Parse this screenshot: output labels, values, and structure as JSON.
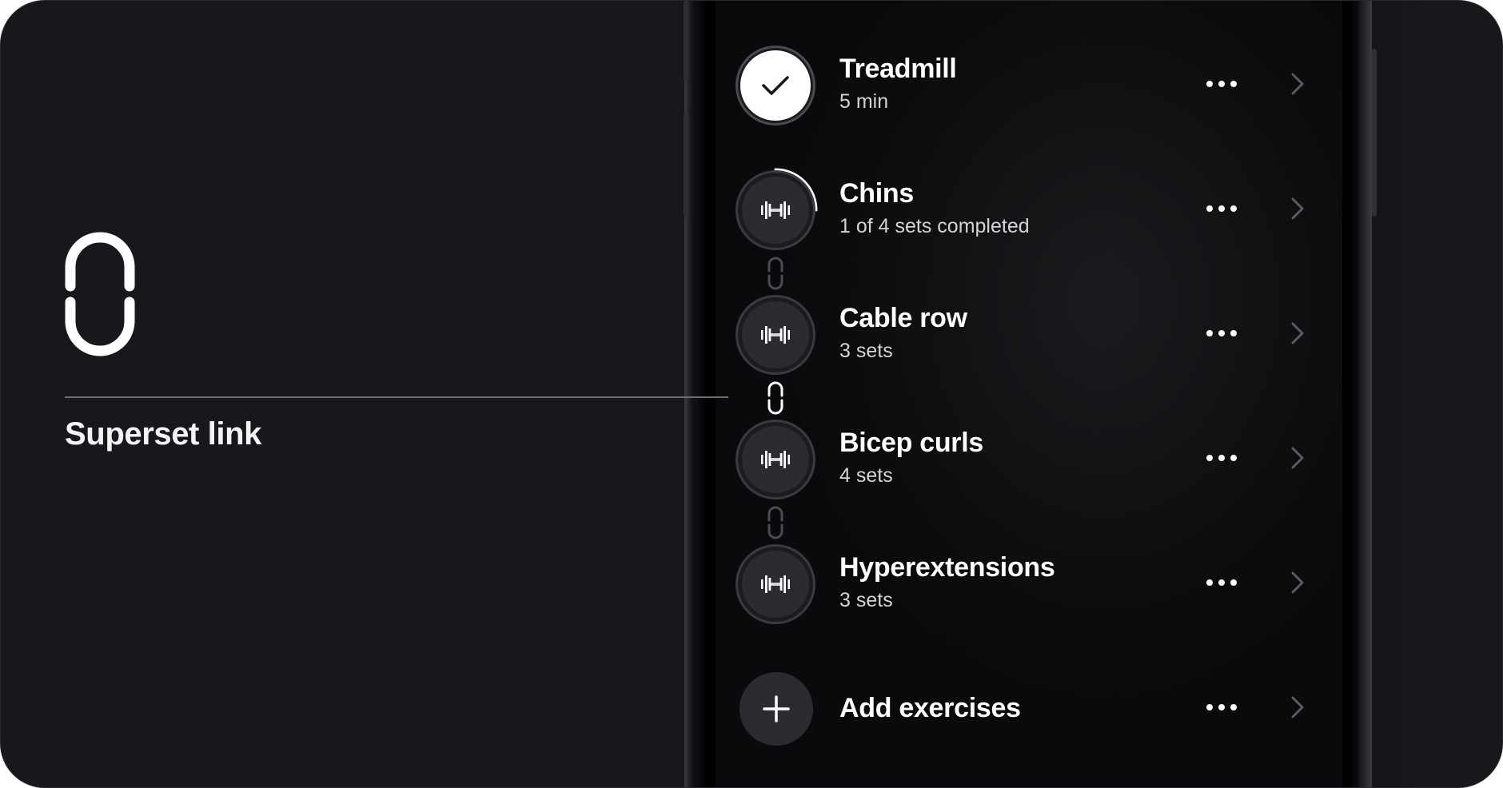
{
  "caption": "Superset link",
  "exercises": [
    {
      "title": "Treadmill",
      "subtitle": "5 min",
      "status": "completed",
      "icon": "checkmark-icon"
    },
    {
      "title": "Chins",
      "subtitle": "1 of 4 sets completed",
      "status": "in-progress",
      "progress": 0.25,
      "icon": "dumbbell-icon"
    },
    {
      "title": "Cable row",
      "subtitle": "3 sets",
      "status": "pending",
      "icon": "dumbbell-icon"
    },
    {
      "title": "Bicep curls",
      "subtitle": "4 sets",
      "status": "pending",
      "icon": "dumbbell-icon"
    },
    {
      "title": "Hyperextensions",
      "subtitle": "3 sets",
      "status": "pending",
      "icon": "dumbbell-icon"
    }
  ],
  "add_row": {
    "title": "Add exercises",
    "icon": "plus-icon"
  },
  "superset_links": [
    {
      "between": [
        "Chins",
        "Cable row"
      ],
      "highlighted": false
    },
    {
      "between": [
        "Cable row",
        "Bicep curls"
      ],
      "highlighted": true
    },
    {
      "between": [
        "Bicep curls",
        "Hyperextensions"
      ],
      "highlighted": false
    }
  ],
  "colors": {
    "background": "#17181c",
    "screen": "#0d0d0f",
    "text_primary": "#ffffff",
    "text_secondary": "#d4d4d8",
    "avatar_fill": "#2b2c31",
    "link_dim": "#4a4b50",
    "link_highlight": "#ffffff"
  }
}
